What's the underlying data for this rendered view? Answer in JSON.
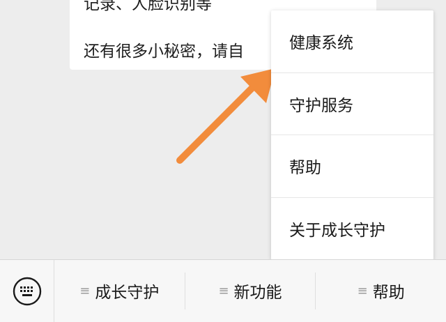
{
  "chat": {
    "message_lines": [
      "记录、人脸识别等",
      "还有很多小秘密，请自"
    ]
  },
  "popup_menu": {
    "items": [
      {
        "label": "健康系统"
      },
      {
        "label": "守护服务"
      },
      {
        "label": "帮助"
      },
      {
        "label": "关于成长守护"
      }
    ]
  },
  "bottom_bar": {
    "keyboard_icon": "keyboard-icon",
    "tabs": [
      {
        "label": "成长守护",
        "icon": "menu-lines-icon"
      },
      {
        "label": "新功能",
        "icon": "menu-lines-icon"
      },
      {
        "label": "帮助",
        "icon": "menu-lines-icon"
      }
    ]
  },
  "colors": {
    "arrow": "#f28c3c",
    "background": "#ededed",
    "menu_background": "#ffffff"
  }
}
